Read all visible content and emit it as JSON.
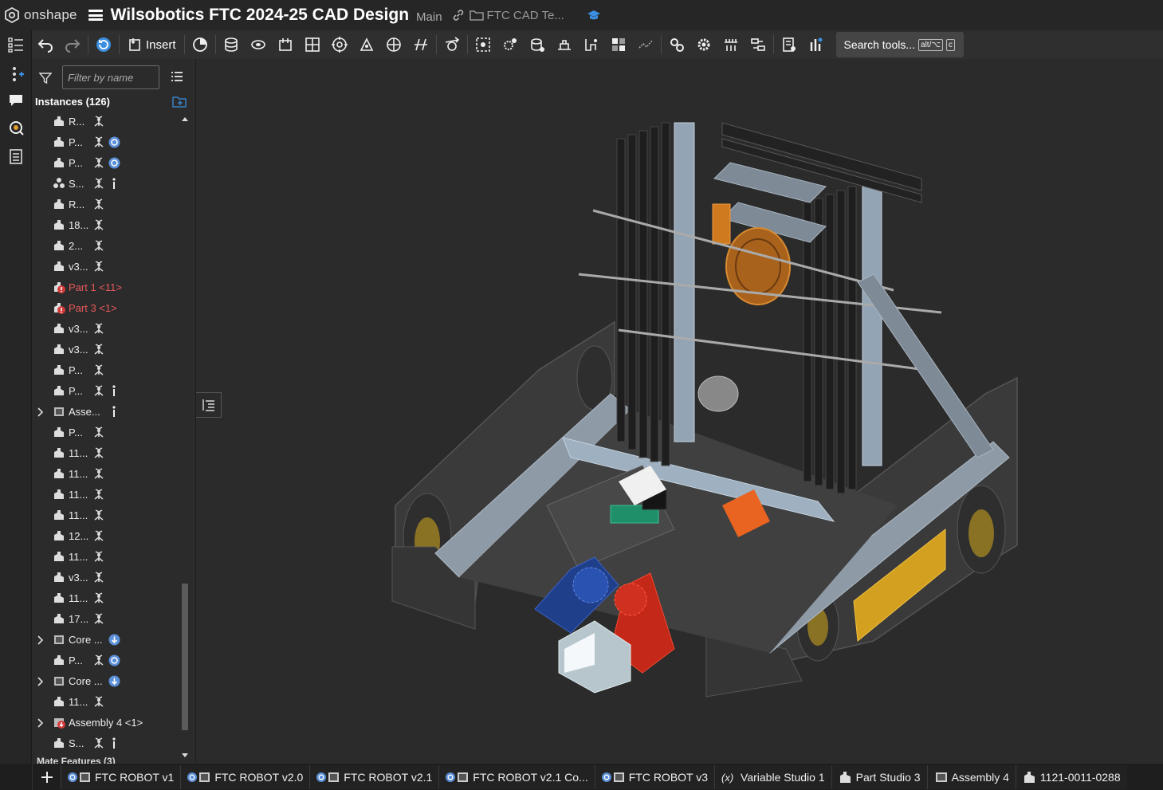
{
  "header": {
    "logo_text": "onshape",
    "doc_title": "Wilsobotics FTC 2024-25 CAD Design",
    "branch": "Main",
    "folder": "FTC CAD Te..."
  },
  "toolbar": {
    "insert_label": "Insert",
    "search_label": "Search tools...",
    "search_key1": "alt/⌥",
    "search_key2": "c"
  },
  "panel": {
    "filter_placeholder": "Filter by name",
    "instances_title": "Instances (126)",
    "mate_features": "Mate Features (3)",
    "rows": [
      {
        "label": "R...",
        "error": false,
        "expand": false,
        "icon": "part-icon",
        "mate": true,
        "badge": ""
      },
      {
        "label": "P...",
        "error": false,
        "expand": false,
        "icon": "part-icon",
        "mate": true,
        "badge": "linked"
      },
      {
        "label": "P...",
        "error": false,
        "expand": false,
        "icon": "part-icon",
        "mate": true,
        "badge": "linked"
      },
      {
        "label": "S...",
        "error": false,
        "expand": false,
        "icon": "subassembly-icon",
        "mate": true,
        "badge": "dots"
      },
      {
        "label": "R...",
        "error": false,
        "expand": false,
        "icon": "part-icon",
        "mate": true,
        "badge": ""
      },
      {
        "label": "18...",
        "error": false,
        "expand": false,
        "icon": "part-icon",
        "mate": true,
        "badge": ""
      },
      {
        "label": "2...",
        "error": false,
        "expand": false,
        "icon": "part-icon",
        "mate": true,
        "badge": ""
      },
      {
        "label": "v3...",
        "error": false,
        "expand": false,
        "icon": "part-icon",
        "mate": true,
        "badge": ""
      },
      {
        "label": "Part 1 <11>",
        "error": true,
        "expand": false,
        "icon": "error-part-icon",
        "mate": false,
        "badge": ""
      },
      {
        "label": "Part 3 <1>",
        "error": true,
        "expand": false,
        "icon": "error-part-icon",
        "mate": false,
        "badge": ""
      },
      {
        "label": "v3...",
        "error": false,
        "expand": false,
        "icon": "part-icon",
        "mate": true,
        "badge": ""
      },
      {
        "label": "v3...",
        "error": false,
        "expand": false,
        "icon": "part-icon",
        "mate": true,
        "badge": ""
      },
      {
        "label": "P...",
        "error": false,
        "expand": false,
        "icon": "part-icon",
        "mate": true,
        "badge": ""
      },
      {
        "label": "P...",
        "error": false,
        "expand": false,
        "icon": "part-icon",
        "mate": true,
        "badge": "dots"
      },
      {
        "label": "Asse...",
        "error": false,
        "expand": true,
        "icon": "assembly-icon",
        "mate": false,
        "badge": "dots"
      },
      {
        "label": "P...",
        "error": false,
        "expand": false,
        "icon": "part-icon",
        "mate": true,
        "badge": ""
      },
      {
        "label": "11...",
        "error": false,
        "expand": false,
        "icon": "part-icon",
        "mate": true,
        "badge": ""
      },
      {
        "label": "11...",
        "error": false,
        "expand": false,
        "icon": "part-icon",
        "mate": true,
        "badge": ""
      },
      {
        "label": "11...",
        "error": false,
        "expand": false,
        "icon": "part-icon",
        "mate": true,
        "badge": ""
      },
      {
        "label": "11...",
        "error": false,
        "expand": false,
        "icon": "part-icon",
        "mate": true,
        "badge": ""
      },
      {
        "label": "12...",
        "error": false,
        "expand": false,
        "icon": "part-icon",
        "mate": true,
        "badge": ""
      },
      {
        "label": "11...",
        "error": false,
        "expand": false,
        "icon": "part-icon",
        "mate": true,
        "badge": ""
      },
      {
        "label": "v3...",
        "error": false,
        "expand": false,
        "icon": "part-icon",
        "mate": true,
        "badge": ""
      },
      {
        "label": "11...",
        "error": false,
        "expand": false,
        "icon": "part-icon",
        "mate": true,
        "badge": ""
      },
      {
        "label": "17...",
        "error": false,
        "expand": false,
        "icon": "part-icon",
        "mate": true,
        "badge": ""
      },
      {
        "label": "Core ...",
        "error": false,
        "expand": true,
        "icon": "assembly-icon",
        "mate": false,
        "badge": "update"
      },
      {
        "label": "P...",
        "error": false,
        "expand": false,
        "icon": "part-icon",
        "mate": true,
        "badge": "linked"
      },
      {
        "label": "Core ...",
        "error": false,
        "expand": true,
        "icon": "assembly-icon",
        "mate": false,
        "badge": "update"
      },
      {
        "label": "11...",
        "error": false,
        "expand": false,
        "icon": "part-icon",
        "mate": true,
        "badge": ""
      },
      {
        "label": "Assembly 4 <1>",
        "error": false,
        "expand": true,
        "icon": "warn-assembly-icon",
        "mate": false,
        "badge": ""
      },
      {
        "label": "S...",
        "error": false,
        "expand": false,
        "icon": "part-icon",
        "mate": true,
        "badge": "dots"
      }
    ]
  },
  "tabs": [
    {
      "label": "FTC ROBOT v1",
      "icon": "linked-assembly-icon"
    },
    {
      "label": "FTC ROBOT v2.0",
      "icon": "linked-assembly-icon"
    },
    {
      "label": "FTC ROBOT v2.1",
      "icon": "linked-assembly-icon"
    },
    {
      "label": "FTC ROBOT v2.1 Co...",
      "icon": "linked-assembly-icon"
    },
    {
      "label": "FTC ROBOT v3",
      "icon": "linked-assembly-icon"
    },
    {
      "label": "Variable Studio 1",
      "icon": "variable-studio-icon"
    },
    {
      "label": "Part Studio 3",
      "icon": "part-studio-icon"
    },
    {
      "label": "Assembly 4",
      "icon": "assembly-icon"
    },
    {
      "label": "1121-0011-0288",
      "icon": "part-studio-icon"
    }
  ]
}
